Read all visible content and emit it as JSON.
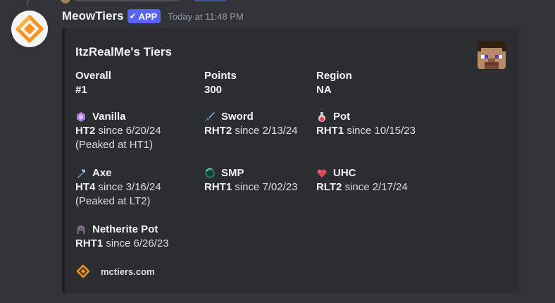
{
  "message": {
    "username": "MeowTiers",
    "badge": "APP",
    "timestamp": "Today at 11:48 PM"
  },
  "embed": {
    "title": "ItzRealMe's Tiers",
    "fields": {
      "overall": {
        "name": "Overall",
        "value": "#1"
      },
      "points": {
        "name": "Points",
        "value": "300"
      },
      "region": {
        "name": "Region",
        "value": "NA"
      },
      "vanilla": {
        "name": "Vanilla",
        "tier": "HT2",
        "since": "since 6/20/24",
        "note": "(Peaked at HT1)"
      },
      "sword": {
        "name": "Sword",
        "tier": "RHT2",
        "since": "since 2/13/24"
      },
      "pot": {
        "name": "Pot",
        "tier": "RHT1",
        "since": "since 10/15/23"
      },
      "axe": {
        "name": "Axe",
        "tier": "HT4",
        "since": "since 3/16/24",
        "note": "(Peaked at LT2)"
      },
      "smp": {
        "name": "SMP",
        "tier": "RHT1",
        "since": "since 7/02/23"
      },
      "uhc": {
        "name": "UHC",
        "tier": "RLT2",
        "since": "since 2/17/24"
      },
      "netherite_pot": {
        "name": "Netherite Pot",
        "tier": "RHT1",
        "since": "since 6/26/23"
      }
    },
    "footer": "mctiers.com"
  },
  "colors": {
    "background": "#313338",
    "embed_bg": "#2b2d31",
    "accent": "#5865f2",
    "logo_orange": "#f7931e"
  },
  "icons": [
    "meowtiers-logo-icon",
    "vanilla-crystal-icon",
    "sword-icon",
    "potion-icon",
    "axe-icon",
    "ender-pearl-icon",
    "heart-icon",
    "netherite-helmet-icon",
    "player-head-icon"
  ]
}
